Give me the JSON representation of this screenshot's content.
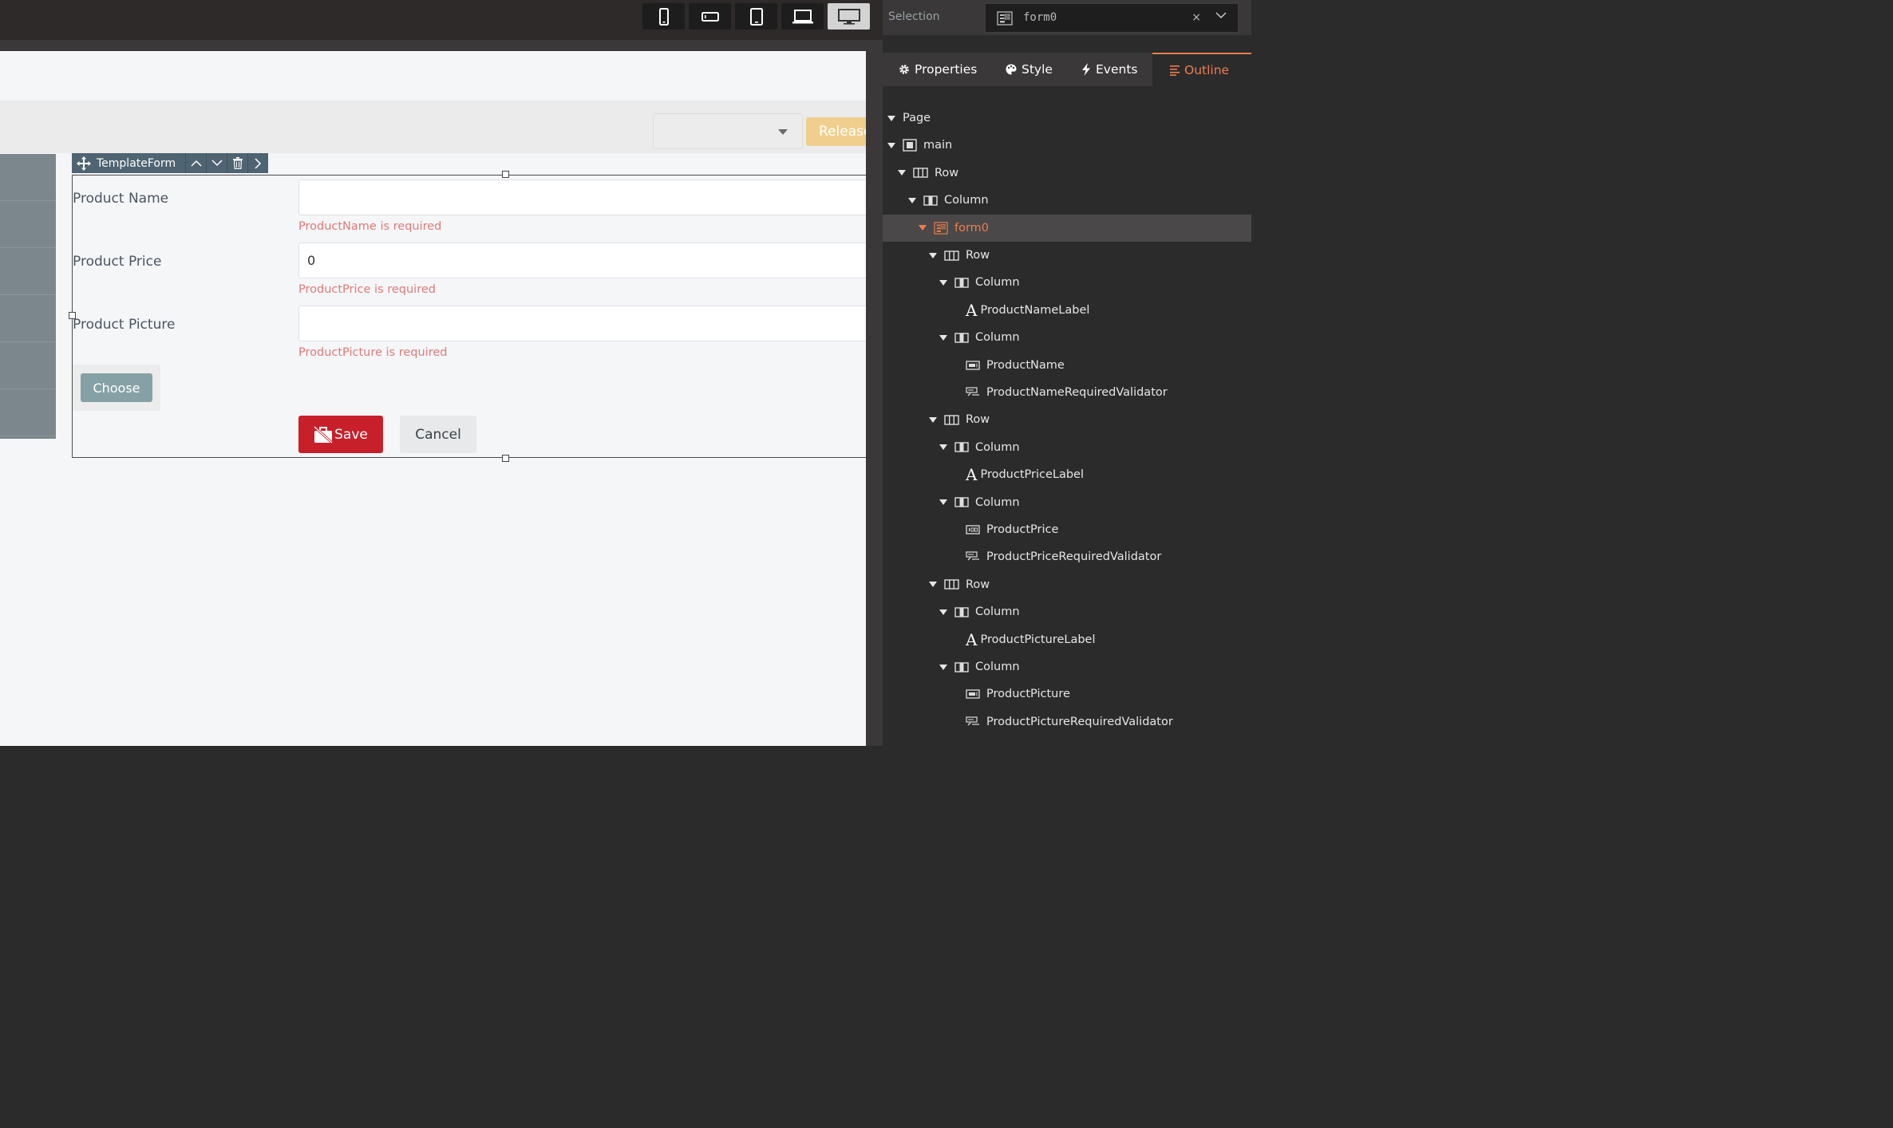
{
  "device_bar": {
    "buttons": [
      {
        "icon": "phone-portrait-icon",
        "active": false
      },
      {
        "icon": "phone-landscape-icon",
        "active": false
      },
      {
        "icon": "tablet-icon",
        "active": false
      },
      {
        "icon": "laptop-icon",
        "active": false
      },
      {
        "icon": "desktop-icon",
        "active": true
      }
    ]
  },
  "canvas": {
    "release_label": "Release",
    "form_tab": {
      "label": "TemplateForm"
    },
    "form": {
      "fields": [
        {
          "label": "Product Name",
          "value": "",
          "error": "ProductName is required"
        },
        {
          "label": "Product Price",
          "value": "0",
          "error": "ProductPrice is required"
        },
        {
          "label": "Product Picture",
          "value": "",
          "error": "ProductPicture is required"
        }
      ],
      "choose_label": "Choose",
      "save_label": "Save",
      "cancel_label": "Cancel"
    }
  },
  "panel": {
    "selection_label": "Selection",
    "selection_value": "form0",
    "selection_clear": "×",
    "tabs": [
      {
        "label": "Properties",
        "icon": "gear-icon",
        "active": false
      },
      {
        "label": "Style",
        "icon": "palette-icon",
        "active": false
      },
      {
        "label": "Events",
        "icon": "lightning-icon",
        "active": false
      },
      {
        "label": "Outline",
        "icon": "outline-list-icon",
        "active": true
      }
    ],
    "outline": [
      {
        "label": "Page",
        "depth": 0,
        "icon": "",
        "expanded": true
      },
      {
        "label": "main",
        "depth": 0,
        "icon": "container-icon",
        "expanded": true
      },
      {
        "label": "Row",
        "depth": 1,
        "icon": "row-icon",
        "expanded": true
      },
      {
        "label": "Column",
        "depth": 2,
        "icon": "column-icon",
        "expanded": true
      },
      {
        "label": "form0",
        "depth": 3,
        "icon": "form-icon",
        "expanded": true,
        "selected": true
      },
      {
        "label": "Row",
        "depth": 4,
        "icon": "row-icon",
        "expanded": true
      },
      {
        "label": "Column",
        "depth": 5,
        "icon": "column-icon",
        "expanded": true
      },
      {
        "label": "ProductNameLabel",
        "depth": 6,
        "icon": "label-icon"
      },
      {
        "label": "Column",
        "depth": 5,
        "icon": "column-icon",
        "expanded": true
      },
      {
        "label": "ProductName",
        "depth": 6,
        "icon": "textbox-icon"
      },
      {
        "label": "ProductNameRequiredValidator",
        "depth": 6,
        "icon": "validator-icon"
      },
      {
        "label": "Row",
        "depth": 4,
        "icon": "row-icon",
        "expanded": true
      },
      {
        "label": "Column",
        "depth": 5,
        "icon": "column-icon",
        "expanded": true
      },
      {
        "label": "ProductPriceLabel",
        "depth": 6,
        "icon": "label-icon"
      },
      {
        "label": "Column",
        "depth": 5,
        "icon": "column-icon",
        "expanded": true
      },
      {
        "label": "ProductPrice",
        "depth": 6,
        "icon": "numeric-icon"
      },
      {
        "label": "ProductPriceRequiredValidator",
        "depth": 6,
        "icon": "validator-icon"
      },
      {
        "label": "Row",
        "depth": 4,
        "icon": "row-icon",
        "expanded": true
      },
      {
        "label": "Column",
        "depth": 5,
        "icon": "column-icon",
        "expanded": true
      },
      {
        "label": "ProductPictureLabel",
        "depth": 6,
        "icon": "label-icon"
      },
      {
        "label": "Column",
        "depth": 5,
        "icon": "column-icon",
        "expanded": true
      },
      {
        "label": "ProductPicture",
        "depth": 6,
        "icon": "textbox-icon"
      },
      {
        "label": "ProductPictureRequiredValidator",
        "depth": 6,
        "icon": "validator-icon"
      }
    ]
  },
  "colors": {
    "accent": "#ee7d4f",
    "danger": "#c8202b",
    "error_text": "#e07a7a",
    "release": "#f0cf8e"
  }
}
